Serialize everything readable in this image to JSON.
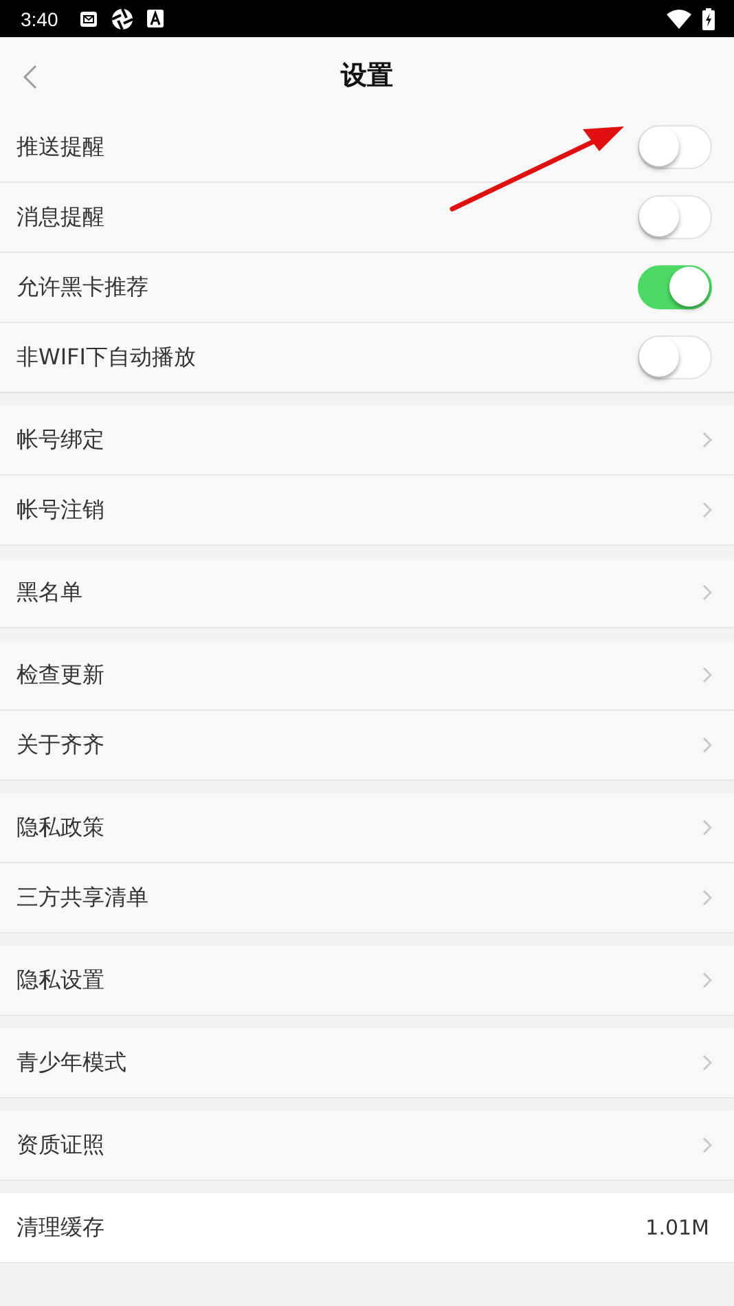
{
  "status_bar": {
    "time": "3:40"
  },
  "header": {
    "title": "设置"
  },
  "groups": [
    {
      "items": [
        {
          "kind": "toggle",
          "label": "推送提醒",
          "on": false
        },
        {
          "kind": "toggle",
          "label": "消息提醒",
          "on": false
        },
        {
          "kind": "toggle",
          "label": "允许黑卡推荐",
          "on": true
        },
        {
          "kind": "toggle",
          "label": "非WIFI下自动播放",
          "on": false
        }
      ]
    },
    {
      "items": [
        {
          "kind": "link",
          "label": "帐号绑定"
        },
        {
          "kind": "link",
          "label": "帐号注销"
        }
      ]
    },
    {
      "items": [
        {
          "kind": "link",
          "label": "黑名单"
        }
      ]
    },
    {
      "items": [
        {
          "kind": "link",
          "label": "检查更新"
        },
        {
          "kind": "link",
          "label": "关于齐齐"
        }
      ]
    },
    {
      "items": [
        {
          "kind": "link",
          "label": "隐私政策"
        },
        {
          "kind": "link",
          "label": "三方共享清单"
        }
      ]
    },
    {
      "items": [
        {
          "kind": "link",
          "label": "隐私设置"
        }
      ]
    },
    {
      "items": [
        {
          "kind": "link",
          "label": "青少年模式"
        }
      ]
    },
    {
      "items": [
        {
          "kind": "link",
          "label": "资质证照"
        }
      ]
    },
    {
      "items": [
        {
          "kind": "value",
          "label": "清理缓存",
          "value": "1.01M"
        }
      ]
    }
  ]
}
